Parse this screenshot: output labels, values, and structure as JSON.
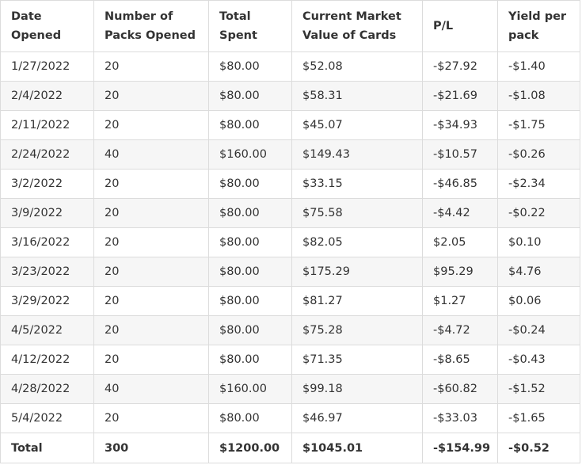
{
  "table": {
    "headers": [
      "Date Opened",
      "Number of Packs Opened",
      "Total Spent",
      "Current Market Value of Cards",
      "P/L",
      "Yield per pack"
    ],
    "rows": [
      [
        "1/27/2022",
        "20",
        "$80.00",
        "$52.08",
        "-$27.92",
        "-$1.40"
      ],
      [
        "2/4/2022",
        "20",
        "$80.00",
        "$58.31",
        "-$21.69",
        "-$1.08"
      ],
      [
        "2/11/2022",
        "20",
        "$80.00",
        "$45.07",
        "-$34.93",
        "-$1.75"
      ],
      [
        "2/24/2022",
        "40",
        "$160.00",
        "$149.43",
        "-$10.57",
        "-$0.26"
      ],
      [
        "3/2/2022",
        "20",
        "$80.00",
        "$33.15",
        "-$46.85",
        "-$2.34"
      ],
      [
        "3/9/2022",
        "20",
        "$80.00",
        "$75.58",
        "-$4.42",
        "-$0.22"
      ],
      [
        "3/16/2022",
        "20",
        "$80.00",
        "$82.05",
        "$2.05",
        "$0.10"
      ],
      [
        "3/23/2022",
        "20",
        "$80.00",
        "$175.29",
        "$95.29",
        "$4.76"
      ],
      [
        "3/29/2022",
        "20",
        "$80.00",
        "$81.27",
        "$1.27",
        "$0.06"
      ],
      [
        "4/5/2022",
        "20",
        "$80.00",
        "$75.28",
        "-$4.72",
        "-$0.24"
      ],
      [
        "4/12/2022",
        "20",
        "$80.00",
        "$71.35",
        "-$8.65",
        "-$0.43"
      ],
      [
        "4/28/2022",
        "40",
        "$160.00",
        "$99.18",
        "-$60.82",
        "-$1.52"
      ],
      [
        "5/4/2022",
        "20",
        "$80.00",
        "$46.97",
        "-$33.03",
        "-$1.65"
      ]
    ],
    "total": [
      "Total",
      "300",
      "$1200.00",
      "$1045.01",
      "-$154.99",
      "-$0.52"
    ]
  }
}
